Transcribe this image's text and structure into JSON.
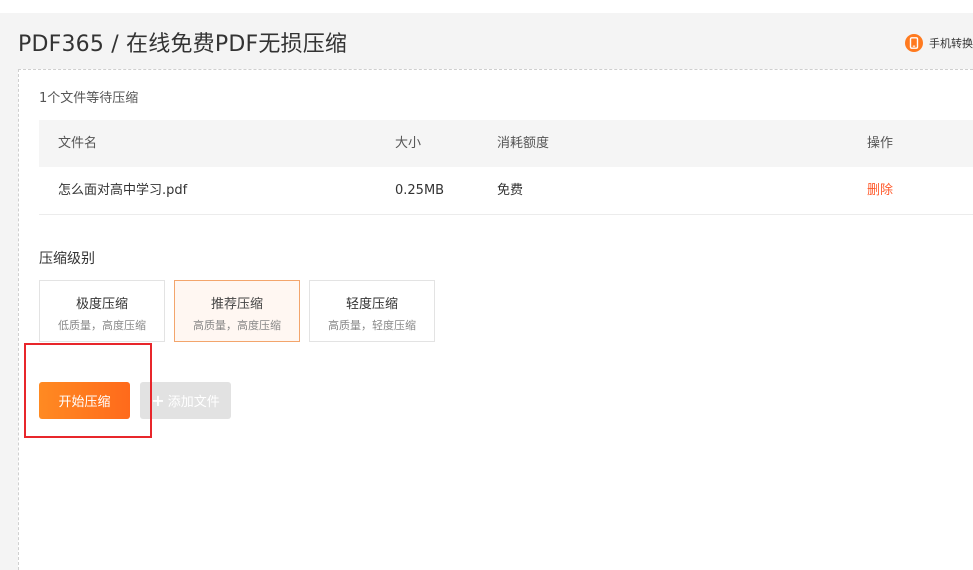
{
  "header": {
    "title": "PDF365 / 在线免费PDF无损压缩",
    "mobile_link_label": "手机转换"
  },
  "upload": {
    "waiting_text": "1个文件等待压缩",
    "table": {
      "columns": {
        "name": "文件名",
        "size": "大小",
        "quota": "消耗额度",
        "operation": "操作"
      },
      "rows": [
        {
          "name": "怎么面对高中学习.pdf",
          "size": "0.25MB",
          "quota": "免费",
          "operation": "删除"
        }
      ]
    }
  },
  "compression": {
    "label": "压缩级别",
    "options": [
      {
        "title": "极度压缩",
        "desc": "低质量，高度压缩"
      },
      {
        "title": "推荐压缩",
        "desc": "高质量，高度压缩"
      },
      {
        "title": "轻度压缩",
        "desc": "高质量，轻度压缩"
      }
    ],
    "selected_option": "推荐压缩"
  },
  "actions": {
    "start_label": "开始压缩",
    "add_label": "添加文件"
  },
  "colors": {
    "accent": "#ff7a1f",
    "delete": "#ff5a2b",
    "selected_border": "#f3a56c",
    "highlight": "#e8262b",
    "disabled_button": "#e2e2e2"
  },
  "icons": {
    "mobile": "phone-icon",
    "add": "plus-icon"
  }
}
